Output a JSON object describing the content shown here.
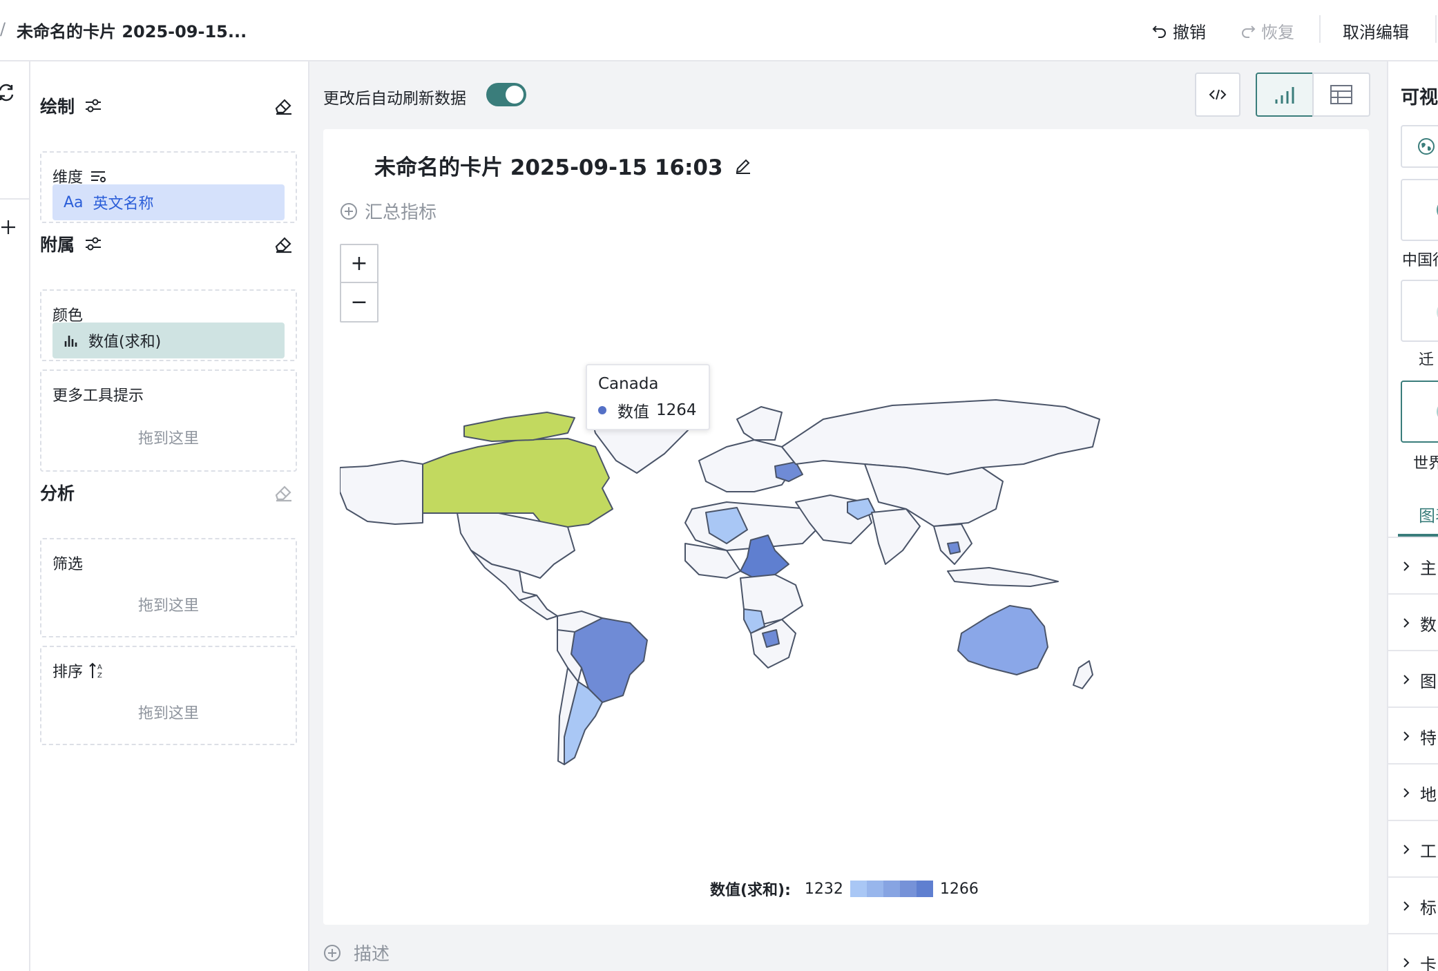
{
  "topbar": {
    "breadcrumb_sep": "/",
    "card_title": "未命名的卡片 2025-09-15...",
    "undo_label": "撤销",
    "redo_label": "恢复",
    "cancel_edit_label": "取消编辑"
  },
  "config": {
    "draw": {
      "title": "绘制",
      "dimension_label": "维度",
      "dimension_field": "英文名称",
      "dimension_prefix": "Aa"
    },
    "attach": {
      "title": "附属",
      "color_label": "颜色",
      "color_field": "数值(求和)",
      "tooltip_label": "更多工具提示",
      "drop_hint": "拖到这里"
    },
    "analysis": {
      "title": "分析",
      "filter_label": "筛选",
      "sort_label": "排序",
      "drop_hint": "拖到这里"
    }
  },
  "main": {
    "auto_refresh_label": "更改后自动刷新数据",
    "auto_refresh_on": true,
    "card_title": "未命名的卡片 2025-09-15 16:03",
    "add_metric_label": "汇总指标",
    "zoom_in": "+",
    "zoom_out": "−",
    "describe_label": "描述"
  },
  "tooltip": {
    "name": "Canada",
    "metric_label": "数值",
    "metric_value": "1264"
  },
  "legend": {
    "title": "数值(求和):",
    "min": "1232",
    "max": "1266",
    "ramp_colors": [
      "#a9c7f5",
      "#98b6ec",
      "#87a4e2",
      "#7692d8",
      "#5f7fd0"
    ]
  },
  "chart_data": {
    "type": "choropleth",
    "title": "未命名的卡片 2025-09-15 16:03",
    "metric": "数值(求和)",
    "range": [
      1232,
      1266
    ],
    "regions": [
      {
        "name": "Canada",
        "value": 1264,
        "highlight_color": "#c2d95f"
      }
    ]
  },
  "right": {
    "title": "可视",
    "thumb_labels": [
      "中国行",
      "迁",
      "世界"
    ],
    "tab_label": "图表",
    "accordion": [
      "主",
      "数",
      "图",
      "特",
      "地",
      "工",
      "标",
      "卡"
    ]
  },
  "colors": {
    "accent": "#3a7d7b",
    "land_default": "#f5f6fa",
    "border": "#4a5468",
    "canada": "#c2d95f"
  }
}
